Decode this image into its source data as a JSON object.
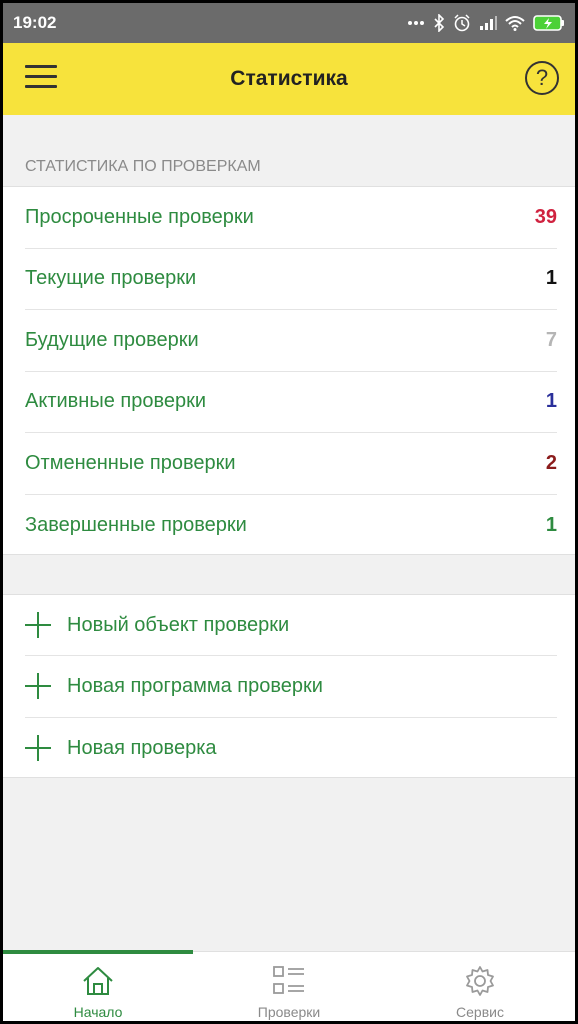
{
  "status_bar": {
    "time": "19:02",
    "icons": [
      "more-dots-icon",
      "bluetooth-icon",
      "alarm-icon",
      "signal-icon",
      "wifi-icon",
      "battery-charging-icon"
    ]
  },
  "app_bar": {
    "title": "Статистика",
    "help_label": "?"
  },
  "stats": {
    "section_title": "СТАТИСТИКА ПО ПРОВЕРКАМ",
    "items": [
      {
        "label": "Просроченные проверки",
        "value": "39",
        "color": "#d0223f"
      },
      {
        "label": "Текущие проверки",
        "value": "1",
        "color": "#111111"
      },
      {
        "label": "Будущие проверки",
        "value": "7",
        "color": "#b5b5b5"
      },
      {
        "label": "Активные проверки",
        "value": "1",
        "color": "#2a2f9a"
      },
      {
        "label": "Отмененные проверки",
        "value": "2",
        "color": "#8b1c1c"
      },
      {
        "label": "Завершенные проверки",
        "value": "1",
        "color": "#2e8b40"
      }
    ]
  },
  "actions": {
    "items": [
      {
        "label": "Новый объект проверки",
        "icon": "plus-icon"
      },
      {
        "label": "Новая программа проверки",
        "icon": "plus-icon"
      },
      {
        "label": "Новая проверка",
        "icon": "plus-icon"
      }
    ]
  },
  "bottom_nav": {
    "items": [
      {
        "label": "Начало",
        "icon": "home-icon",
        "active": true
      },
      {
        "label": "Проверки",
        "icon": "list-icon",
        "active": false
      },
      {
        "label": "Сервис",
        "icon": "gear-icon",
        "active": false
      }
    ]
  },
  "colors": {
    "accent_green": "#2e8b40",
    "app_bar_yellow": "#f7e33c"
  }
}
